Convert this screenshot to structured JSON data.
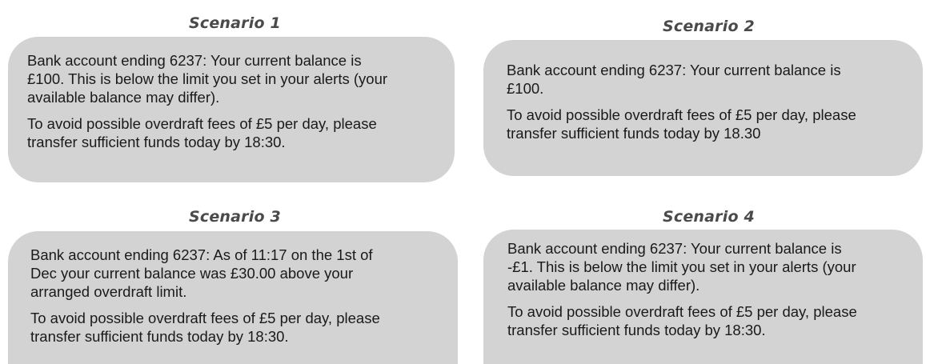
{
  "scenarios": [
    {
      "title": "Scenario 1",
      "paragraphs": [
        "Bank account ending 6237: Your current balance is\n£100. This is below the limit you set in your alerts (your\navailable balance may differ).",
        "To avoid possible overdraft fees of £5 per day, please\ntransfer sufficient funds today by 18:30."
      ]
    },
    {
      "title": "Scenario 2",
      "paragraphs": [
        "Bank account ending 6237: Your current balance is\n£100.",
        "To avoid possible overdraft fees of £5 per day, please\ntransfer sufficient funds today by 18.30"
      ]
    },
    {
      "title": "Scenario 3",
      "paragraphs": [
        "Bank account ending 6237: As of 11:17 on the 1st of\nDec your current balance was £30.00 above your\narranged overdraft limit.",
        "To avoid possible overdraft fees of £5 per day, please\ntransfer sufficient funds today by 18:30."
      ]
    },
    {
      "title": "Scenario 4",
      "paragraphs": [
        "Bank account ending 6237: Your current balance is\n-£1. This is below the limit you set in your alerts (your\navailable balance may differ).",
        "To avoid possible overdraft fees of £5 per day, please\ntransfer sufficient funds today by 18:30."
      ]
    }
  ],
  "colors": {
    "bubble_background": "#d3d3d3",
    "title_text": "#4a4a4a",
    "body_text": "#1a1a1a"
  }
}
